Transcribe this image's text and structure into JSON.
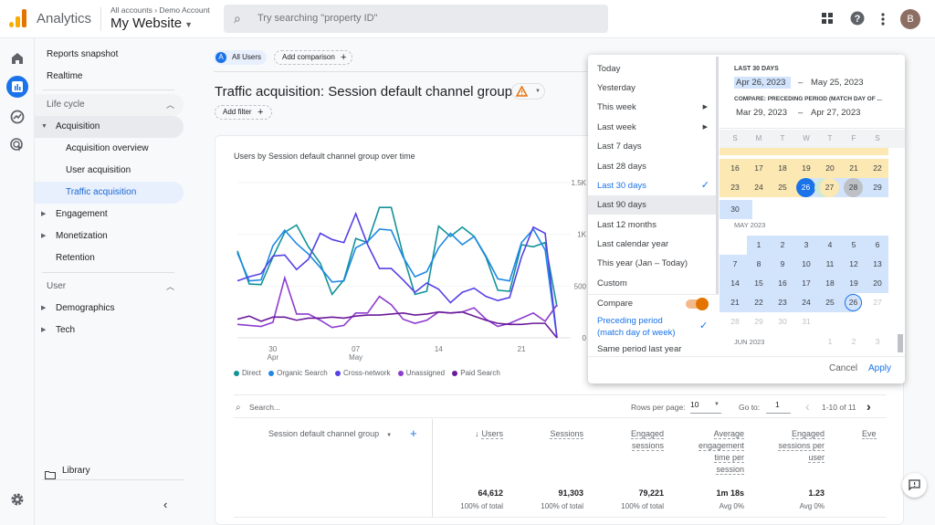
{
  "topbar": {
    "app_name": "Analytics",
    "breadcrumb": "All accounts › Demo Account",
    "property": "My Website",
    "search_placeholder": "Try searching \"property ID\"",
    "avatar_letter": "B",
    "icons": [
      "apps-grid-icon",
      "help-icon",
      "more-vert-icon"
    ]
  },
  "rail": {
    "icons": [
      "home-icon",
      "reports-icon",
      "explore-icon",
      "advertising-icon",
      "settings-icon"
    ]
  },
  "nav": {
    "reports_snapshot": "Reports snapshot",
    "realtime": "Realtime",
    "lifecycle": "Life cycle",
    "acquisition": "Acquisition",
    "acq_overview": "Acquisition overview",
    "user_acq": "User acquisition",
    "traffic_acq": "Traffic acquisition",
    "engagement": "Engagement",
    "monetization": "Monetization",
    "retention": "Retention",
    "user": "User",
    "demographics": "Demographics",
    "tech": "Tech",
    "library": "Library"
  },
  "header": {
    "segment_badge": "A",
    "segment": "All Users",
    "add_comparison": "Add comparison",
    "title": "Traffic acquisition: Session default channel group",
    "add_filter": "Add filter"
  },
  "chart_data": {
    "type": "line",
    "title": "Users by Session default channel group over time",
    "ylim": [
      0,
      1500
    ],
    "yticks": [
      "0",
      "500",
      "1K",
      "1.5K"
    ],
    "xticks": [
      {
        "day": "30",
        "month": "Apr",
        "i": 3
      },
      {
        "day": "07",
        "month": "May",
        "i": 10
      },
      {
        "day": "14",
        "month": "",
        "i": 17
      },
      {
        "day": "21",
        "month": "",
        "i": 24
      }
    ],
    "series": [
      {
        "name": "Direct",
        "color": "#12939a",
        "values": [
          840,
          520,
          515,
          780,
          1020,
          1090,
          880,
          720,
          420,
          560,
          960,
          920,
          1260,
          1260,
          800,
          420,
          450,
          1080,
          980,
          1070,
          980,
          780,
          460,
          450,
          900,
          880,
          920,
          300
        ]
      },
      {
        "name": "Organic Search",
        "color": "#1e88e5",
        "values": [
          820,
          550,
          560,
          890,
          1040,
          910,
          810,
          680,
          540,
          550,
          870,
          930,
          1050,
          1040,
          780,
          590,
          640,
          870,
          1010,
          900,
          980,
          790,
          570,
          550,
          920,
          1050,
          850,
          0
        ]
      },
      {
        "name": "Cross-network",
        "color": "#5541e5",
        "values": [
          550,
          590,
          620,
          790,
          800,
          660,
          760,
          1010,
          950,
          920,
          1200,
          900,
          670,
          670,
          560,
          440,
          530,
          470,
          340,
          440,
          480,
          400,
          360,
          390,
          780,
          1070,
          1010,
          0
        ]
      },
      {
        "name": "Unassigned",
        "color": "#8e3ccf",
        "values": [
          130,
          120,
          110,
          150,
          580,
          230,
          230,
          170,
          100,
          120,
          240,
          240,
          400,
          320,
          180,
          140,
          170,
          250,
          240,
          250,
          290,
          180,
          110,
          140,
          190,
          240,
          160,
          320
        ]
      },
      {
        "name": "Paid Search",
        "color": "#6a1a9a",
        "values": [
          180,
          210,
          160,
          200,
          200,
          170,
          190,
          190,
          200,
          190,
          210,
          220,
          220,
          230,
          240,
          220,
          230,
          250,
          240,
          250,
          210,
          170,
          140,
          130,
          130,
          140,
          140,
          0
        ]
      }
    ]
  },
  "table": {
    "search_placeholder": "Search...",
    "rows_per_page_label": "Rows per page:",
    "rows_per_page": "10",
    "goto_label": "Go to:",
    "goto": "1",
    "range": "1-10 of 11",
    "dim_header": "Session default channel group",
    "columns": [
      {
        "label": "Users",
        "total": "64,612",
        "sub": "100% of total"
      },
      {
        "label": "Sessions",
        "total": "91,303",
        "sub": "100% of total"
      },
      {
        "label": "Engaged sessions",
        "total": "79,221",
        "sub": "100% of total"
      },
      {
        "label": "Average engagement time per session",
        "total": "1m 18s",
        "sub": "Avg 0%"
      },
      {
        "label": "Engaged sessions per user",
        "total": "1.23",
        "sub": "Avg 0%"
      },
      {
        "label": "Eve",
        "total": "",
        "sub": ""
      }
    ]
  },
  "datepicker": {
    "options": [
      "Today",
      "Yesterday",
      "This week",
      "Last week",
      "Last 7 days",
      "Last 28 days",
      "Last 30 days",
      "Last 90 days",
      "Last 12 months",
      "Last calendar year",
      "This year (Jan – Today)",
      "Custom"
    ],
    "selected": "Last 30 days",
    "compare_label": "Compare",
    "compare_on": true,
    "compare_opt1": "Preceding period",
    "compare_opt1b": "(match day of week)",
    "compare_opt2": "Same period last year",
    "range_label": "LAST 30 DAYS",
    "start": "Apr 26, 2023",
    "end": "May 25, 2023",
    "compare_range_label": "COMPARE: PRECEDING PERIOD (MATCH DAY OF ...",
    "cstart": "Mar 29, 2023",
    "cend": "Apr 27, 2023",
    "dash": "–",
    "dows": [
      "S",
      "M",
      "T",
      "W",
      "T",
      "F",
      "S"
    ],
    "may_label": "MAY 2023",
    "jun_label": "JUN 2023",
    "cancel": "Cancel",
    "apply": "Apply"
  }
}
